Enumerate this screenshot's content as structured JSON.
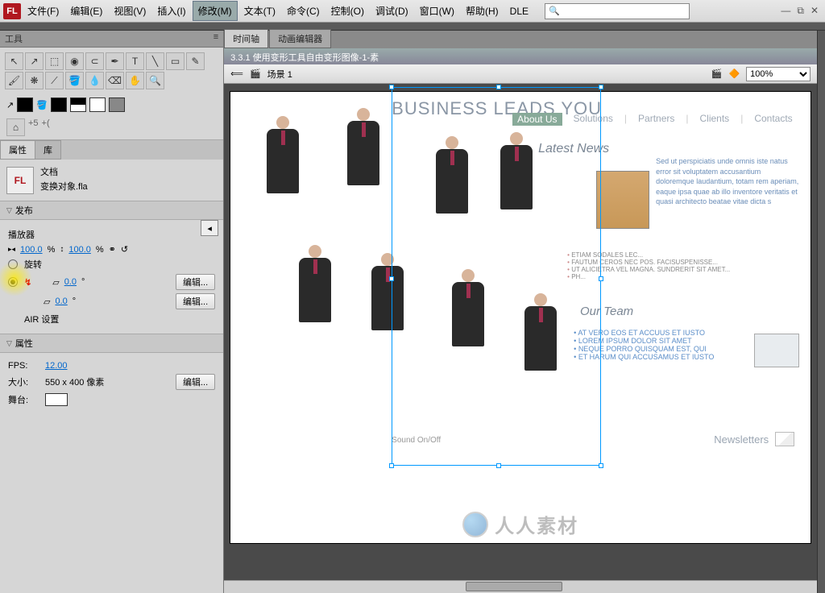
{
  "menubar": {
    "items": [
      "文件(F)",
      "编辑(E)",
      "视图(V)",
      "插入(I)",
      "修改(M)",
      "文本(T)",
      "命令(C)",
      "控制(O)",
      "调试(D)",
      "窗口(W)",
      "帮助(H)",
      "DLE"
    ],
    "active_index": 4
  },
  "search": {
    "placeholder": ""
  },
  "tools_panel": {
    "title": "工具"
  },
  "options_row": [
    "⌂",
    "+5",
    "+("
  ],
  "props_tabs": {
    "t1": "属性",
    "t2": "库"
  },
  "doc_info": {
    "l1": "文档",
    "l2": "变换对象.fla"
  },
  "publish": {
    "title": "发布",
    "play_label": "播放器",
    "scale_w": "100.0",
    "scale_h": "100.0",
    "unit": "%",
    "rotate_label": "旋转",
    "align_label": "倾斜",
    "edit_btn": "编辑...",
    "v1": "0.0",
    "v2": "0.0",
    "deg": "°",
    "air_label": "AIR 设置"
  },
  "attrs": {
    "title": "属性",
    "fps_label": "FPS:",
    "fps_val": "12.00",
    "size_label": "大小:",
    "size_val": "550 x 400 像素",
    "edit_btn": "编辑...",
    "stage_label": "舞台:"
  },
  "doc_tabs": {
    "tab1": "时间轴",
    "tab2": "动画编辑器"
  },
  "doc_header": "3.3.1 使用变形工具自由变形图像-1-素",
  "scene_bar": {
    "back": "⟸",
    "scene_icon": "🎬",
    "scene_name": "场景 1",
    "zoom": "100%"
  },
  "stage": {
    "headline": "BUSINESS LEADS YOU",
    "nav": [
      "About Us",
      "Solutions",
      "Partners",
      "Clients",
      "Contacts"
    ],
    "latest": "Latest News",
    "news_text": "Sed ut perspiciatis unde omnis iste natus error sit voluptatem accusantium doloremque laudantium, totam rem aperiam, eaque ipsa quae ab illo inventore veritatis et quasi architecto beatae vitae dicta s",
    "mid_list": [
      "ETIAM SODALES LEC...",
      "FAUTUM CEROS NEC POS. FACISUSPENISSE...",
      "UT ALICIETRA VEL MAGNA. SUNDRERIT SIT AMET...",
      "PH..."
    ],
    "team_h": "Our Team",
    "team_list": [
      "AT VERO EOS ET ACCUUS ET IUSTO",
      "LOREM IPSUM DOLOR SIT AMET",
      "NEQUE PORRO QUISQUAM EST, QUI",
      "ET HARUM QUI ACCUSAMUS ET IUSTO"
    ],
    "newsletter": "Newsletters",
    "sound": "Sound On/Off"
  },
  "watermark": "人人素材"
}
